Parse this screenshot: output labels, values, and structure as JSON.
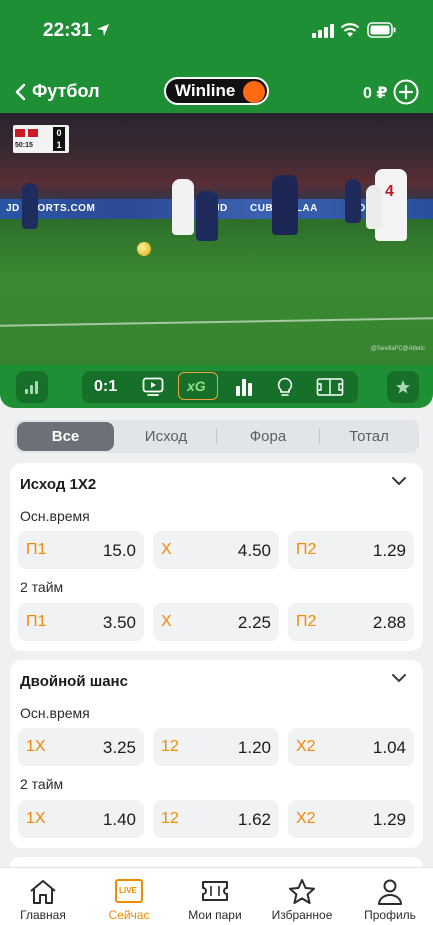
{
  "status_bar": {
    "time": "22:31"
  },
  "nav": {
    "back_label": "Футбол",
    "logo_text": "Winline",
    "balance": "0 ₽"
  },
  "video": {
    "score_home": "0",
    "score_away": "1",
    "match_clock": "50:15",
    "board_texts": [
      "JD SPORTS.COM",
      "JD",
      "CUBRENLAA",
      "JD"
    ],
    "player_number": "4",
    "watermark": "@SevillaFC@Atletic"
  },
  "controls": {
    "score": "0:1",
    "xg_label": "xG"
  },
  "tabs": [
    {
      "label": "Все",
      "active": true
    },
    {
      "label": "Исход",
      "active": false
    },
    {
      "label": "Фора",
      "active": false
    },
    {
      "label": "Тотал",
      "active": false
    }
  ],
  "markets": [
    {
      "title": "Исход 1Х2",
      "groups": [
        {
          "label": "Осн.время",
          "odds": [
            {
              "k": "П1",
              "v": "15.0"
            },
            {
              "k": "Х",
              "v": "4.50"
            },
            {
              "k": "П2",
              "v": "1.29"
            }
          ]
        },
        {
          "label": "2 тайм",
          "odds": [
            {
              "k": "П1",
              "v": "3.50"
            },
            {
              "k": "Х",
              "v": "2.25"
            },
            {
              "k": "П2",
              "v": "2.88"
            }
          ]
        }
      ]
    },
    {
      "title": "Двойной шанс",
      "groups": [
        {
          "label": "Осн.время",
          "odds": [
            {
              "k": "1Х",
              "v": "3.25"
            },
            {
              "k": "12",
              "v": "1.20"
            },
            {
              "k": "Х2",
              "v": "1.04"
            }
          ]
        },
        {
          "label": "2 тайм",
          "odds": [
            {
              "k": "1Х",
              "v": "1.40"
            },
            {
              "k": "12",
              "v": "1.62"
            },
            {
              "k": "Х2",
              "v": "1.29"
            }
          ]
        }
      ]
    }
  ],
  "tabbar": [
    {
      "label": "Главная",
      "icon": "home-icon",
      "active": false
    },
    {
      "label": "Сейчас",
      "icon": "live-icon",
      "active": true,
      "badge": "LIVE"
    },
    {
      "label": "Мои пари",
      "icon": "ticket-icon",
      "active": false
    },
    {
      "label": "Избранное",
      "icon": "star-icon",
      "active": false
    },
    {
      "label": "Профиль",
      "icon": "person-icon",
      "active": false
    }
  ],
  "colors": {
    "brand_green": "#1f8f36",
    "accent_orange": "#f08a00",
    "logo_dot": "#ff6a13"
  }
}
